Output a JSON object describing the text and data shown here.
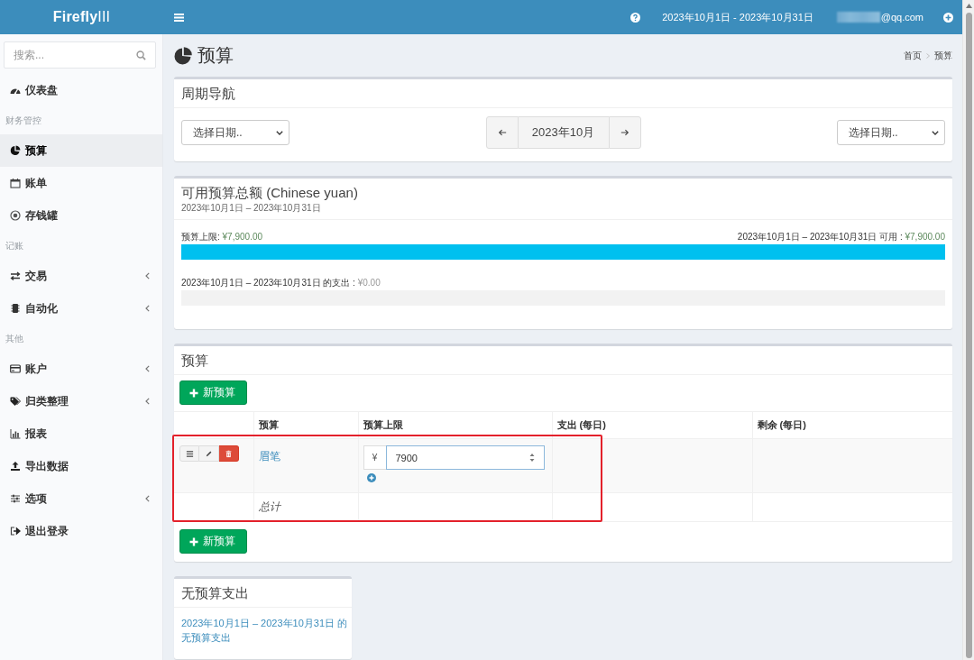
{
  "header": {
    "logo": "**Firefly**III",
    "date_range": "2023年10月1日 - 2023年10月31日",
    "user": "@qq.com"
  },
  "sidebar": {
    "search": {
      "placeholder": "搜索..."
    },
    "items": [
      {
        "kind": "link",
        "label": "仪表盘",
        "selected": false,
        "submenu": false
      },
      {
        "kind": "header",
        "label": "财务管控"
      },
      {
        "kind": "link",
        "label": "预算",
        "selected": true,
        "submenu": false
      },
      {
        "kind": "link",
        "label": "账单",
        "selected": false,
        "submenu": false
      },
      {
        "kind": "link",
        "label": "存钱罐",
        "selected": false,
        "submenu": false
      },
      {
        "kind": "header",
        "label": "记账"
      },
      {
        "kind": "link",
        "label": "交易",
        "selected": false,
        "submenu": true
      },
      {
        "kind": "link",
        "label": "自动化",
        "selected": false,
        "submenu": true
      },
      {
        "kind": "header",
        "label": "其他"
      },
      {
        "kind": "link",
        "label": "账户",
        "selected": false,
        "submenu": true
      },
      {
        "kind": "link",
        "label": "归类整理",
        "selected": false,
        "submenu": true
      },
      {
        "kind": "link",
        "label": "报表",
        "selected": false,
        "submenu": false
      },
      {
        "kind": "link",
        "label": "导出数据",
        "selected": false,
        "submenu": false
      },
      {
        "kind": "link",
        "label": "选项",
        "selected": false,
        "submenu": true
      },
      {
        "kind": "link",
        "label": "退出登录",
        "selected": false,
        "submenu": false
      }
    ]
  },
  "page": {
    "title": "预算",
    "breadcrumb": [
      "首页",
      "预算"
    ]
  },
  "period_nav": {
    "title": "周期导航",
    "start_select": "选择日期..",
    "current": "2023年10月",
    "end_select": "选择日期.."
  },
  "available": {
    "title": "可用预算总额 (Chinese yuan)",
    "subtitle": "2023年10月1日 – 2023年10月31日",
    "limit_label": "预算上限:",
    "limit_amount": "¥7,900.00",
    "available_label": "2023年10月1日 – 2023年10月31日 可用 :",
    "available_amount": "¥7,900.00",
    "budget_bar": {
      "level": 1
    },
    "spent_label": "2023年10月1日 – 2023年10月31日 的支出 :",
    "spent_amount": "¥0.00"
  },
  "budgets": {
    "title": "预算",
    "new_button_top": "新预算",
    "columns": [
      "预算",
      "预算上限",
      "支出 (每日)",
      "剩余 (每日)"
    ],
    "rows": [
      {
        "name": "眉笔",
        "currency": "¥",
        "limit": "7900"
      }
    ],
    "total_label": "总计",
    "new_button_bottom": "新预算",
    "highlight": true
  },
  "no_budget": {
    "title": "无预算支出",
    "link": "2023年10月1日 – 2023年10月31日 的无预算支出"
  }
}
